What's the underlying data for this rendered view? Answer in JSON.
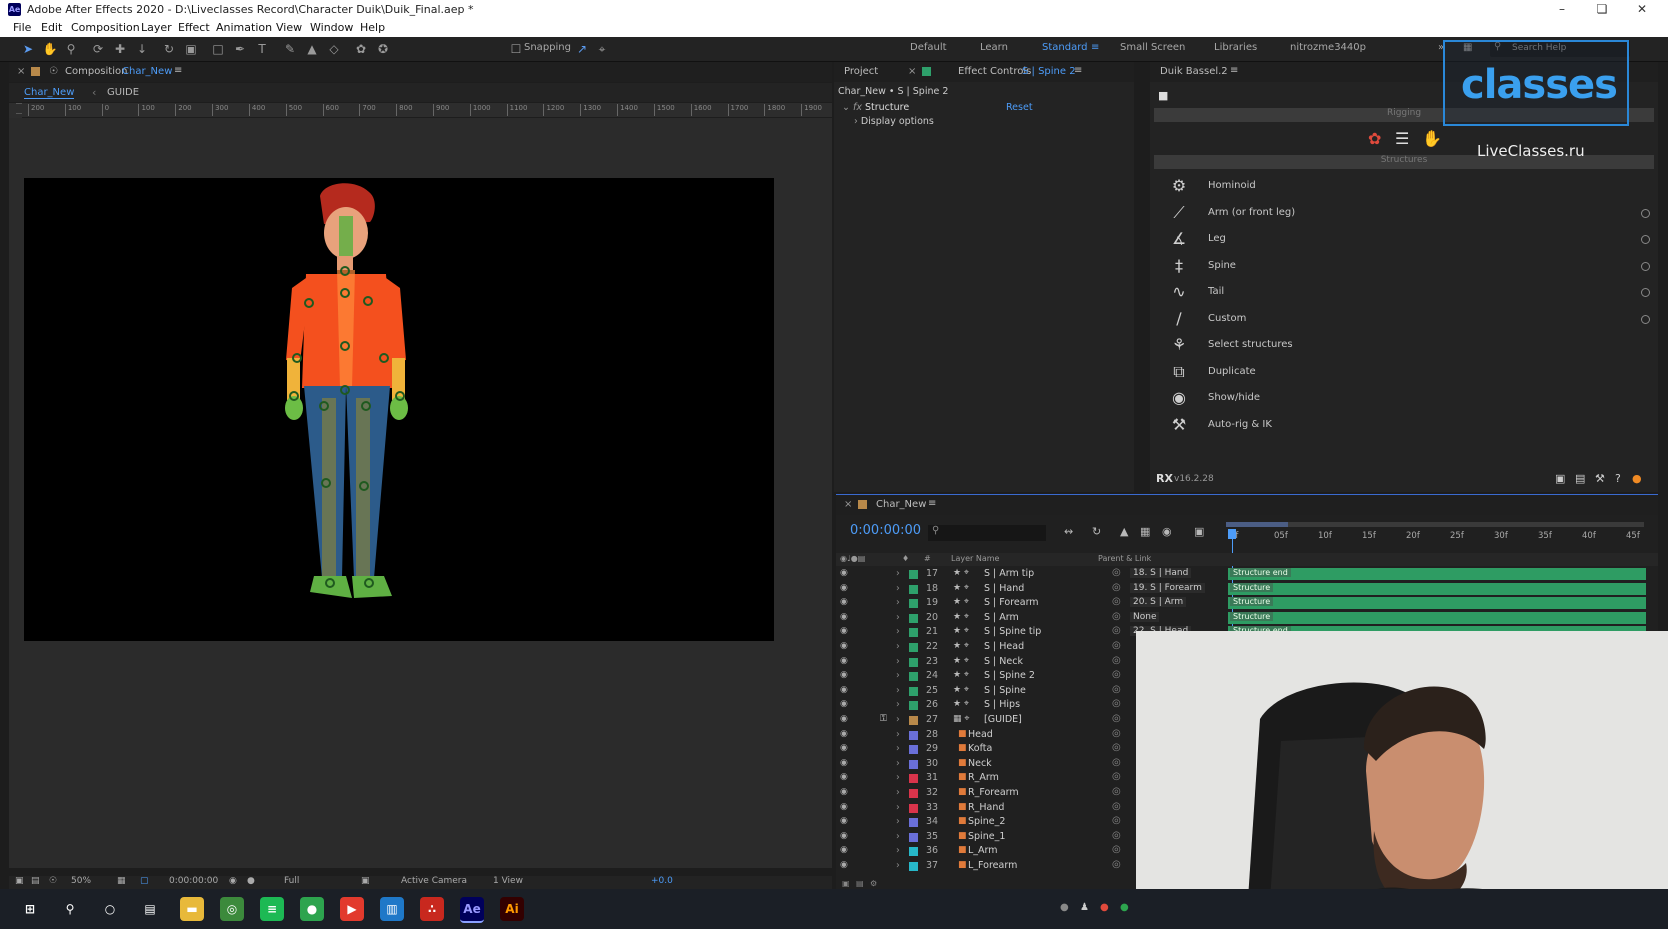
{
  "app": {
    "title": "Adobe After Effects 2020 - D:\\Liveclasses Record\\Character Duik\\Duik_Final.aep *",
    "logo": "Ae"
  },
  "menu": [
    "File",
    "Edit",
    "Composition",
    "Layer",
    "Effect",
    "Animation",
    "View",
    "Window",
    "Help"
  ],
  "toolbar": {
    "snapping": "Snapping",
    "workspaces": [
      "Default",
      "Learn",
      "Standard",
      "Small Screen",
      "Libraries",
      "nitrozme3440p"
    ],
    "active_workspace": "Standard",
    "search_placeholder": "Search Help"
  },
  "composition": {
    "panel_label": "Composition",
    "comp_name": "Char_New",
    "tabs": [
      "Char_New",
      "GUIDE"
    ],
    "ruler_ticks": [
      "200",
      "100",
      "0",
      "100",
      "200",
      "300",
      "400",
      "500",
      "600",
      "700",
      "800",
      "900",
      "1000",
      "1100",
      "1200",
      "1300",
      "1400",
      "1500",
      "1600",
      "1700",
      "1800",
      "1900"
    ],
    "footer": {
      "zoom": "50%",
      "timecode": "0:00:00:00",
      "resolution": "Full",
      "camera": "Active Camera",
      "views": "1 View",
      "exposure": "+0.0"
    }
  },
  "effect_controls": {
    "tab_project": "Project",
    "tab_effect": "Effect Controls",
    "tab_effect_layer": "S | Spine 2",
    "header": "Char_New • S | Spine 2",
    "effect_name": "Structure",
    "reset": "Reset",
    "sub_item": "Display options"
  },
  "duik": {
    "title": "Duik Bassel.2",
    "rigging_label": "Rigging",
    "structures_label": "Structures",
    "items": [
      {
        "label": "Hominoid",
        "icon": "hominoid-icon",
        "glyph": "⚙",
        "dot": false
      },
      {
        "label": "Arm (or front leg)",
        "icon": "arm-icon",
        "glyph": "⟋",
        "dot": true
      },
      {
        "label": "Leg",
        "icon": "leg-icon",
        "glyph": "∡",
        "dot": true
      },
      {
        "label": "Spine",
        "icon": "spine-icon",
        "glyph": "‡",
        "dot": true
      },
      {
        "label": "Tail",
        "icon": "tail-icon",
        "glyph": "∿",
        "dot": true
      },
      {
        "label": "Custom",
        "icon": "custom-icon",
        "glyph": "∕",
        "dot": true
      },
      {
        "label": "Select structures",
        "icon": "select-structures-icon",
        "glyph": "⚘",
        "dot": false
      },
      {
        "label": "Duplicate",
        "icon": "duplicate-icon",
        "glyph": "⧉",
        "dot": false
      },
      {
        "label": "Show/hide",
        "icon": "show-hide-icon",
        "glyph": "◉",
        "dot": false
      },
      {
        "label": "Auto-rig & IK",
        "icon": "auto-rig-icon",
        "glyph": "⚒",
        "dot": false
      }
    ],
    "version": "v16.2.28",
    "watermark_logo": "classes",
    "watermark_text": "LiveClasses.ru"
  },
  "timeline": {
    "comp_name": "Char_New",
    "timecode": "0:00:00:00",
    "col_layer_name": "Layer Name",
    "col_parent": "Parent & Link",
    "ruler": [
      "0f",
      "05f",
      "10f",
      "15f",
      "20f",
      "25f",
      "30f",
      "35f",
      "40f",
      "45f"
    ],
    "layers": [
      {
        "num": "17",
        "name": "S | Arm tip",
        "parent": "18. S | Hand",
        "color": "#2ea06b",
        "type": "null",
        "bar": "Structure end"
      },
      {
        "num": "18",
        "name": "S | Hand",
        "parent": "19. S | Forearm",
        "color": "#2ea06b",
        "type": "null",
        "bar": "Structure"
      },
      {
        "num": "19",
        "name": "S | Forearm",
        "parent": "20. S | Arm",
        "color": "#2ea06b",
        "type": "null",
        "bar": "Structure"
      },
      {
        "num": "20",
        "name": "S | Arm",
        "parent": "None",
        "color": "#2ea06b",
        "type": "null",
        "bar": "Structure"
      },
      {
        "num": "21",
        "name": "S | Spine tip",
        "parent": "22. S | Head",
        "color": "#2ea06b",
        "type": "null",
        "bar": "Structure end"
      },
      {
        "num": "22",
        "name": "S | Head",
        "parent": "",
        "color": "#2ea06b",
        "type": "null",
        "bar": ""
      },
      {
        "num": "23",
        "name": "S | Neck",
        "parent": "",
        "color": "#2ea06b",
        "type": "null",
        "bar": ""
      },
      {
        "num": "24",
        "name": "S | Spine 2",
        "parent": "",
        "color": "#2ea06b",
        "type": "null",
        "bar": ""
      },
      {
        "num": "25",
        "name": "S | Spine",
        "parent": "",
        "color": "#2ea06b",
        "type": "null",
        "bar": ""
      },
      {
        "num": "26",
        "name": "S | Hips",
        "parent": "",
        "color": "#2ea06b",
        "type": "null",
        "bar": ""
      },
      {
        "num": "27",
        "name": "[GUIDE]",
        "parent": "",
        "color": "#b8894a",
        "type": "comp",
        "bar": ""
      },
      {
        "num": "28",
        "name": "Head",
        "parent": "",
        "color": "#6a6fd8",
        "type": "ai",
        "bar": ""
      },
      {
        "num": "29",
        "name": "Kofta",
        "parent": "",
        "color": "#6a6fd8",
        "type": "ai",
        "bar": ""
      },
      {
        "num": "30",
        "name": "Neck",
        "parent": "",
        "color": "#6a6fd8",
        "type": "ai",
        "bar": ""
      },
      {
        "num": "31",
        "name": "R_Arm",
        "parent": "",
        "color": "#d9344b",
        "type": "ai",
        "bar": ""
      },
      {
        "num": "32",
        "name": "R_Forearm",
        "parent": "",
        "color": "#d9344b",
        "type": "ai",
        "bar": ""
      },
      {
        "num": "33",
        "name": "R_Hand",
        "parent": "",
        "color": "#d9344b",
        "type": "ai",
        "bar": ""
      },
      {
        "num": "34",
        "name": "Spine_2",
        "parent": "",
        "color": "#6a6fd8",
        "type": "ai",
        "bar": ""
      },
      {
        "num": "35",
        "name": "Spine_1",
        "parent": "",
        "color": "#6a6fd8",
        "type": "ai",
        "bar": ""
      },
      {
        "num": "36",
        "name": "L_Arm",
        "parent": "",
        "color": "#27b8c9",
        "type": "ai",
        "bar": ""
      },
      {
        "num": "37",
        "name": "L_Forearm",
        "parent": "",
        "color": "#27b8c9",
        "type": "ai",
        "bar": ""
      }
    ]
  },
  "taskbar": {
    "apps": [
      {
        "icon": "windows-start-icon",
        "glyph": "⊞",
        "color": "transparent"
      },
      {
        "icon": "search-icon",
        "glyph": "⚲",
        "color": "transparent"
      },
      {
        "icon": "cortana-icon",
        "glyph": "○",
        "color": "transparent"
      },
      {
        "icon": "task-view-icon",
        "glyph": "▤",
        "color": "transparent"
      },
      {
        "icon": "file-explorer-icon",
        "glyph": "▬",
        "color": "#e8b93a"
      },
      {
        "icon": "chrome-icon",
        "glyph": "◎",
        "color": "#3c8a3c"
      },
      {
        "icon": "spotify-icon",
        "glyph": "≡",
        "color": "#1db954"
      },
      {
        "icon": "green-app-icon",
        "glyph": "●",
        "color": "#2da44e"
      },
      {
        "icon": "record-app-icon",
        "glyph": "▶",
        "color": "#e23a2d"
      },
      {
        "icon": "trello-icon",
        "glyph": "▥",
        "color": "#1f78c8"
      },
      {
        "icon": "acrobat-icon",
        "glyph": "∴",
        "color": "#c8281e"
      },
      {
        "icon": "after-effects-icon",
        "glyph": "Ae",
        "color": "#00005b"
      },
      {
        "icon": "illustrator-icon",
        "glyph": "Ai",
        "color": "#330000"
      }
    ]
  }
}
